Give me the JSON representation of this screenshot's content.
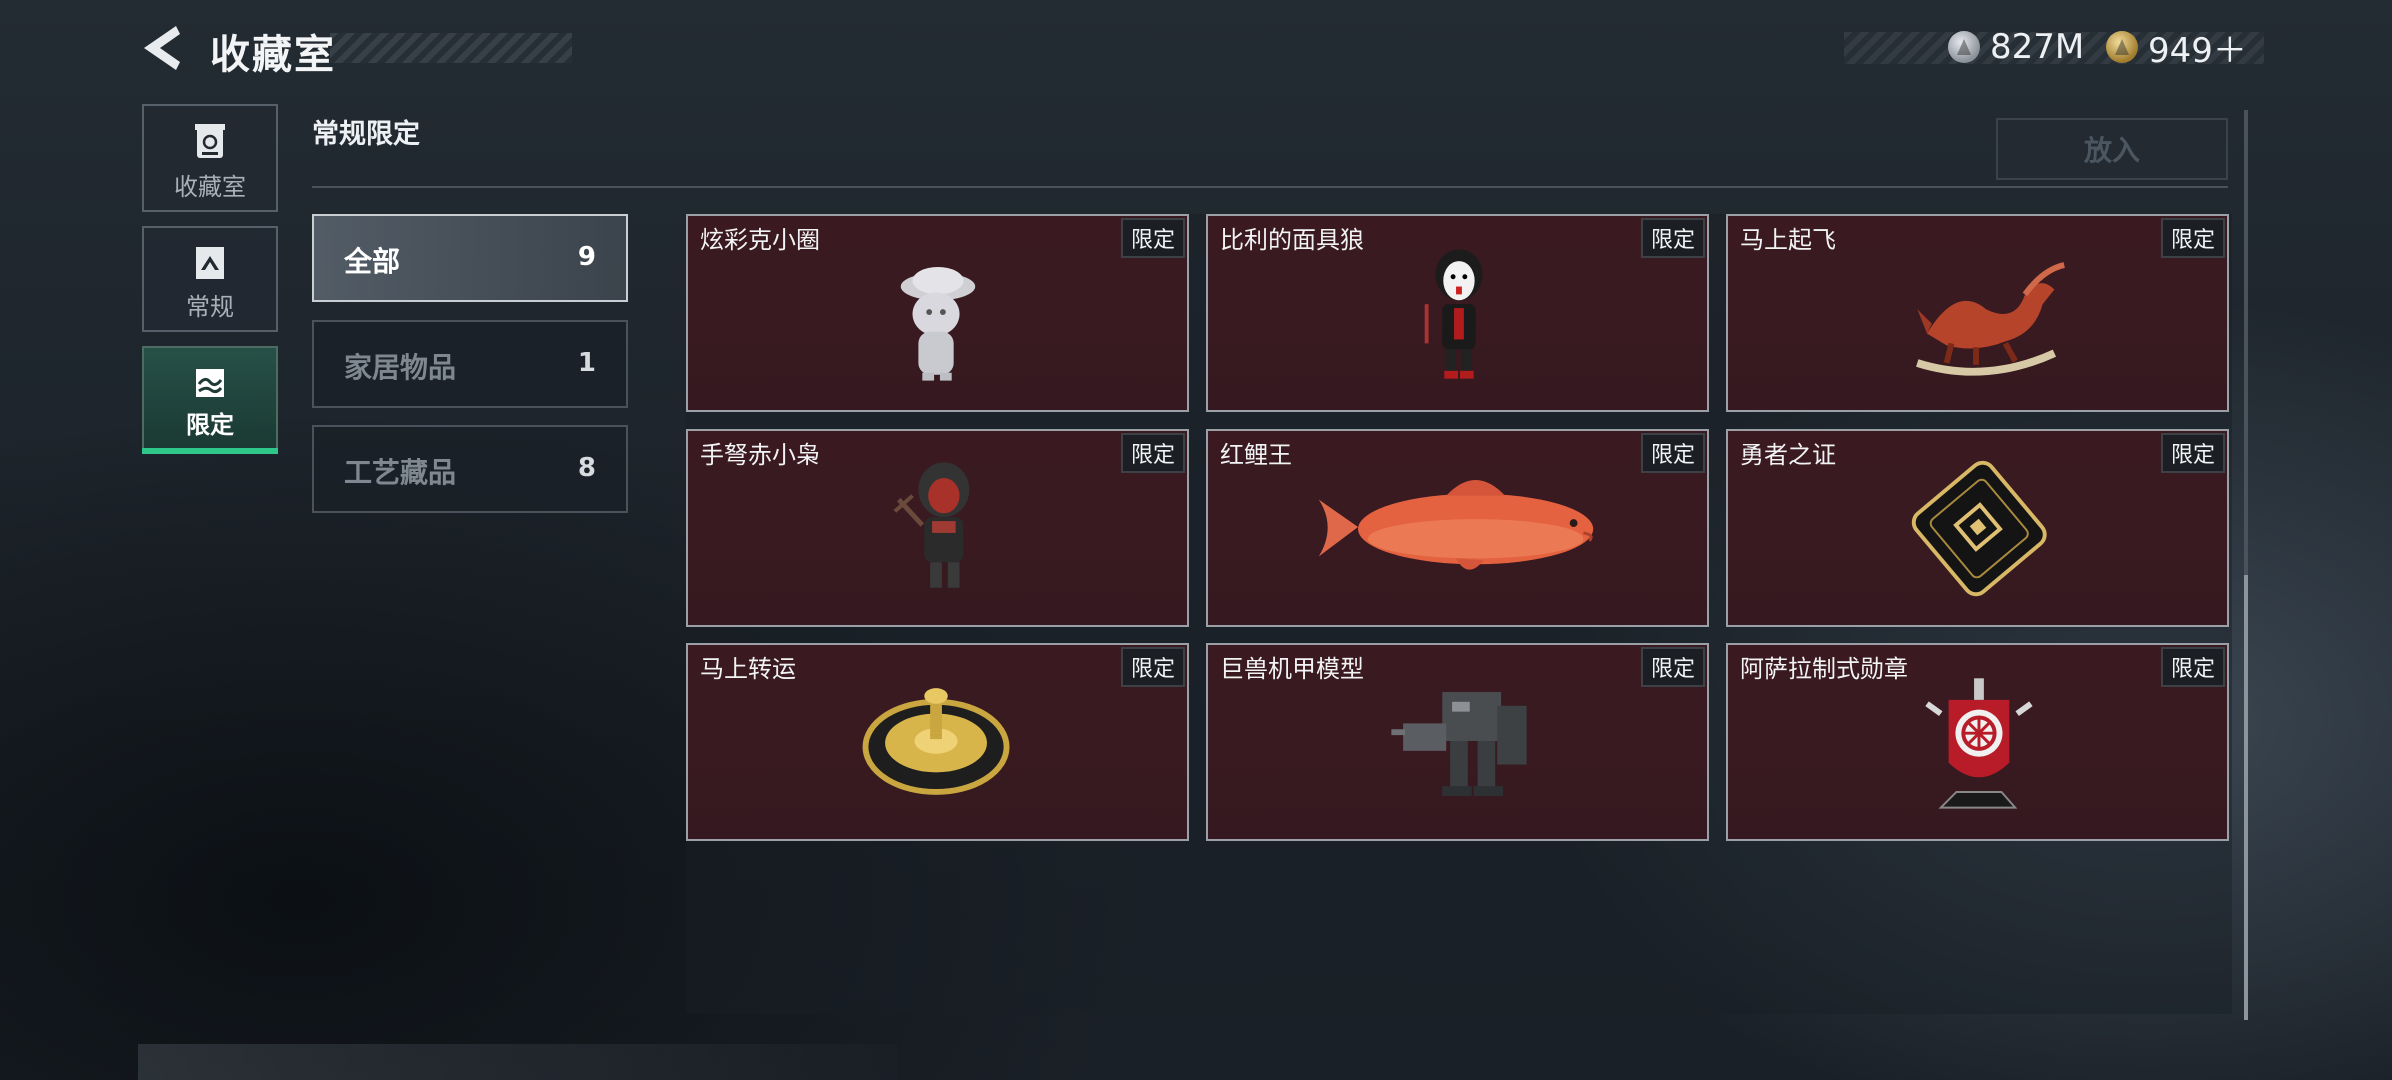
{
  "header": {
    "title": "收藏室",
    "back_icon": "back-chevron-icon",
    "currencies": [
      {
        "name": "silver-coin-icon",
        "value": "827M"
      },
      {
        "name": "gold-coin-icon",
        "value": "949＋"
      }
    ]
  },
  "sidebar": {
    "items": [
      {
        "label": "收藏室",
        "icon": "trash-bin-icon",
        "active": false
      },
      {
        "label": "常规",
        "icon": "framed-picture-icon",
        "active": false
      },
      {
        "label": "限定",
        "icon": "landscape-icon",
        "active": true
      }
    ],
    "accent_color": "#2fc689"
  },
  "section": {
    "title": "常规限定",
    "put_button": "放入"
  },
  "categories": [
    {
      "label": "全部",
      "count": "9",
      "active": true
    },
    {
      "label": "家居物品",
      "count": "1",
      "active": false
    },
    {
      "label": "工艺藏品",
      "count": "8",
      "active": false
    }
  ],
  "items": [
    {
      "name": "炫彩克小圈",
      "tag": "限定",
      "icon": "bunny-figurine-icon"
    },
    {
      "name": "比利的面具狼",
      "tag": "限定",
      "icon": "masked-doll-icon"
    },
    {
      "name": "马上起飞",
      "tag": "限定",
      "icon": "rocking-horse-icon"
    },
    {
      "name": "手弩赤小枭",
      "tag": "限定",
      "icon": "hooded-figure-icon"
    },
    {
      "name": "红鲤王",
      "tag": "限定",
      "icon": "red-carp-icon"
    },
    {
      "name": "勇者之证",
      "tag": "限定",
      "icon": "gold-card-icon"
    },
    {
      "name": "马上转运",
      "tag": "限定",
      "icon": "golden-disc-icon"
    },
    {
      "name": "巨兽机甲模型",
      "tag": "限定",
      "icon": "mech-robot-icon"
    },
    {
      "name": "阿萨拉制式勋章",
      "tag": "限定",
      "icon": "medal-badge-icon"
    }
  ],
  "colors": {
    "card_bg": "#3a1a20",
    "card_border": "#9aa0a6"
  }
}
